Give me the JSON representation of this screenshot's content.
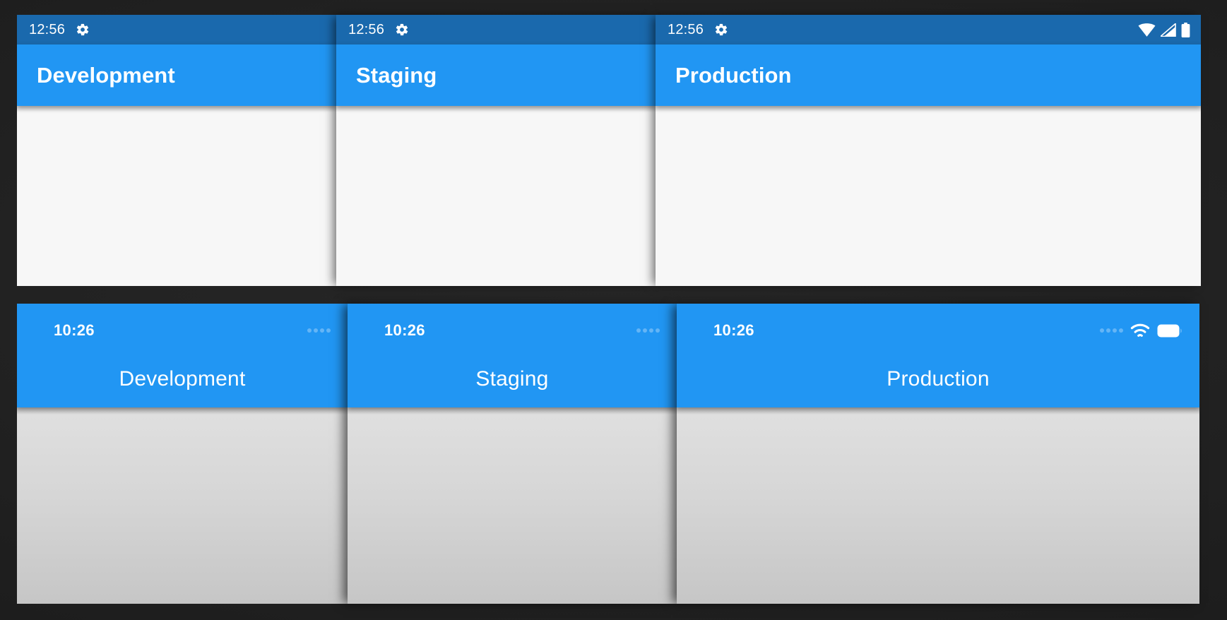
{
  "background_color": "#232323",
  "rows": [
    {
      "platform": "android",
      "status_bar_color": "#1a69ad",
      "app_bar_color": "#2196f3",
      "body_color": "#f7f7f7",
      "panels": [
        {
          "title": "Development",
          "time": "12:56",
          "settings_icon": "gear-icon",
          "show_status_icons": false,
          "status_icons": []
        },
        {
          "title": "Staging",
          "time": "12:56",
          "settings_icon": "gear-icon",
          "show_status_icons": false,
          "status_icons": []
        },
        {
          "title": "Production",
          "time": "12:56",
          "settings_icon": "gear-icon",
          "show_status_icons": true,
          "status_icons": [
            "wifi-icon",
            "cellular-signal-icon",
            "battery-icon"
          ]
        }
      ]
    },
    {
      "platform": "ios",
      "nav_bar_color": "#2196f3",
      "body_color": "#d6d6d6",
      "panels": [
        {
          "title": "Development",
          "time": "10:26",
          "show_status_icons": false,
          "signal_dots": 4,
          "status_icons": []
        },
        {
          "title": "Staging",
          "time": "10:26",
          "show_status_icons": false,
          "signal_dots": 4,
          "status_icons": []
        },
        {
          "title": "Production",
          "time": "10:26",
          "show_status_icons": true,
          "signal_dots": 4,
          "status_icons": [
            "wifi-icon",
            "battery-icon"
          ]
        }
      ]
    }
  ]
}
